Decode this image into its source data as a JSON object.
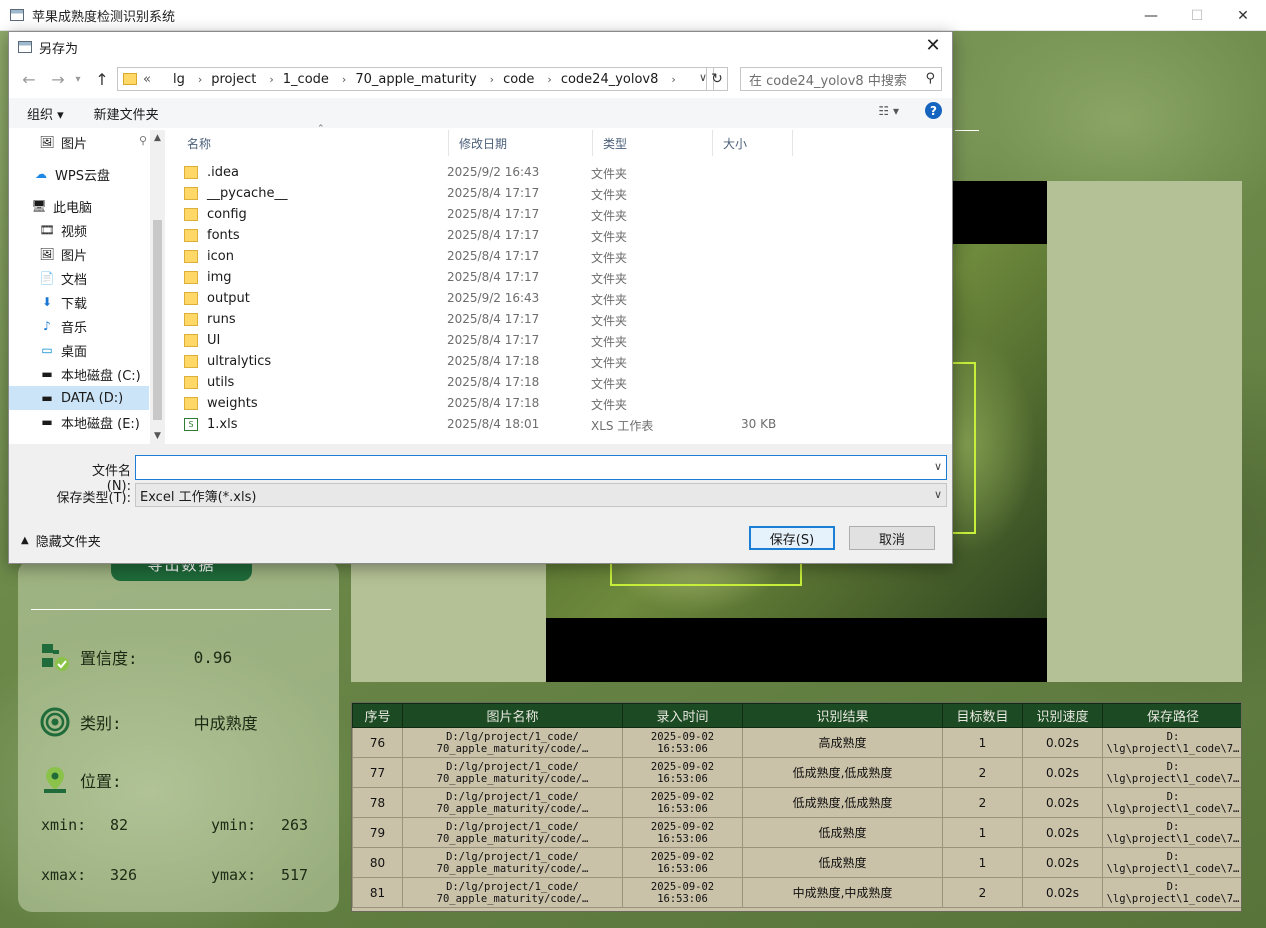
{
  "app": {
    "title": "苹果成熟度检测识别系统",
    "export_btn": "导出数据",
    "info": {
      "confidence_label": "置信度:",
      "confidence_value": "0.96",
      "class_label": "类别:",
      "class_value": "中成熟度",
      "position_label": "位置:",
      "xmin_label": "xmin:",
      "xmin_value": "82",
      "ymin_label": "ymin:",
      "ymin_value": "263",
      "xmax_label": "xmax:",
      "xmax_value": "326",
      "ymax_label": "ymax:",
      "ymax_value": "517"
    },
    "table": {
      "headers": [
        "序号",
        "图片名称",
        "录入时间",
        "识别结果",
        "目标数目",
        "识别速度",
        "保存路径"
      ],
      "rows": [
        {
          "id": "76",
          "name1": "D:/lg/project/1_code/",
          "name2": "70_apple_maturity/code/…",
          "t1": "2025-09-02",
          "t2": "16:53:06",
          "result": "高成熟度",
          "count": "1",
          "speed": "0.02s",
          "p1": "D:",
          "p2": "\\lg\\project\\1_code\\7…"
        },
        {
          "id": "77",
          "name1": "D:/lg/project/1_code/",
          "name2": "70_apple_maturity/code/…",
          "t1": "2025-09-02",
          "t2": "16:53:06",
          "result": "低成熟度,低成熟度",
          "count": "2",
          "speed": "0.02s",
          "p1": "D:",
          "p2": "\\lg\\project\\1_code\\7…"
        },
        {
          "id": "78",
          "name1": "D:/lg/project/1_code/",
          "name2": "70_apple_maturity/code/…",
          "t1": "2025-09-02",
          "t2": "16:53:06",
          "result": "低成熟度,低成熟度",
          "count": "2",
          "speed": "0.02s",
          "p1": "D:",
          "p2": "\\lg\\project\\1_code\\7…"
        },
        {
          "id": "79",
          "name1": "D:/lg/project/1_code/",
          "name2": "70_apple_maturity/code/…",
          "t1": "2025-09-02",
          "t2": "16:53:06",
          "result": "低成熟度",
          "count": "1",
          "speed": "0.02s",
          "p1": "D:",
          "p2": "\\lg\\project\\1_code\\7…"
        },
        {
          "id": "80",
          "name1": "D:/lg/project/1_code/",
          "name2": "70_apple_maturity/code/…",
          "t1": "2025-09-02",
          "t2": "16:53:06",
          "result": "低成熟度",
          "count": "1",
          "speed": "0.02s",
          "p1": "D:",
          "p2": "\\lg\\project\\1_code\\7…"
        },
        {
          "id": "81",
          "name1": "D:/lg/project/1_code/",
          "name2": "70_apple_maturity/code/…",
          "t1": "2025-09-02",
          "t2": "16:53:06",
          "result": "中成熟度,中成熟度",
          "count": "2",
          "speed": "0.02s",
          "p1": "D:",
          "p2": "\\lg\\project\\1_code\\7…"
        }
      ]
    }
  },
  "dialog": {
    "title": "另存为",
    "breadcrumb": [
      "lg",
      "project",
      "1_code",
      "70_apple_maturity",
      "code",
      "code24_yolov8"
    ],
    "breadcrumb_prefix": "«",
    "search_placeholder": "在 code24_yolov8 中搜索",
    "toolbar": {
      "organize": "组织 ▾",
      "new_folder": "新建文件夹"
    },
    "nav_items": [
      {
        "label": "图片",
        "icon": "pictures-icon",
        "pinned": true
      },
      {
        "label": "WPS云盘",
        "icon": "cloud-icon"
      },
      {
        "label": "此电脑",
        "icon": "computer-icon"
      },
      {
        "label": "视频",
        "icon": "video-icon"
      },
      {
        "label": "图片",
        "icon": "pictures-icon"
      },
      {
        "label": "文档",
        "icon": "document-icon"
      },
      {
        "label": "下载",
        "icon": "download-icon"
      },
      {
        "label": "音乐",
        "icon": "music-icon"
      },
      {
        "label": "桌面",
        "icon": "desktop-icon"
      },
      {
        "label": "本地磁盘 (C:)",
        "icon": "drive-c-icon"
      },
      {
        "label": "DATA (D:)",
        "icon": "drive-icon",
        "selected": true
      },
      {
        "label": "本地磁盘 (E:)",
        "icon": "drive-icon"
      }
    ],
    "columns": {
      "name": "名称",
      "date": "修改日期",
      "type": "类型",
      "size": "大小"
    },
    "files": [
      {
        "name": ".idea",
        "date": "2025/9/2 16:43",
        "type": "文件夹",
        "size": ""
      },
      {
        "name": "__pycache__",
        "date": "2025/8/4 17:17",
        "type": "文件夹",
        "size": ""
      },
      {
        "name": "config",
        "date": "2025/8/4 17:17",
        "type": "文件夹",
        "size": ""
      },
      {
        "name": "fonts",
        "date": "2025/8/4 17:17",
        "type": "文件夹",
        "size": ""
      },
      {
        "name": "icon",
        "date": "2025/8/4 17:17",
        "type": "文件夹",
        "size": ""
      },
      {
        "name": "img",
        "date": "2025/8/4 17:17",
        "type": "文件夹",
        "size": ""
      },
      {
        "name": "output",
        "date": "2025/9/2 16:43",
        "type": "文件夹",
        "size": ""
      },
      {
        "name": "runs",
        "date": "2025/8/4 17:17",
        "type": "文件夹",
        "size": ""
      },
      {
        "name": "UI",
        "date": "2025/8/4 17:17",
        "type": "文件夹",
        "size": ""
      },
      {
        "name": "ultralytics",
        "date": "2025/8/4 17:18",
        "type": "文件夹",
        "size": ""
      },
      {
        "name": "utils",
        "date": "2025/8/4 17:18",
        "type": "文件夹",
        "size": ""
      },
      {
        "name": "weights",
        "date": "2025/8/4 17:18",
        "type": "文件夹",
        "size": ""
      },
      {
        "name": "1.xls",
        "date": "2025/8/4 18:01",
        "type": "XLS 工作表",
        "size": "30 KB",
        "xls": true
      }
    ],
    "filename_label": "文件名(N):",
    "filename_value": "",
    "filetype_label": "保存类型(T):",
    "filetype_value": "Excel 工作簿(*.xls)",
    "hide_folders": "隐藏文件夹",
    "save_btn": "保存(S)",
    "cancel_btn": "取消"
  },
  "colors": {
    "table_header": "#1c4a22",
    "bbox": "#c8ef3a",
    "export_btn": "#1f6b3a",
    "accent": "#1a7fd4"
  }
}
